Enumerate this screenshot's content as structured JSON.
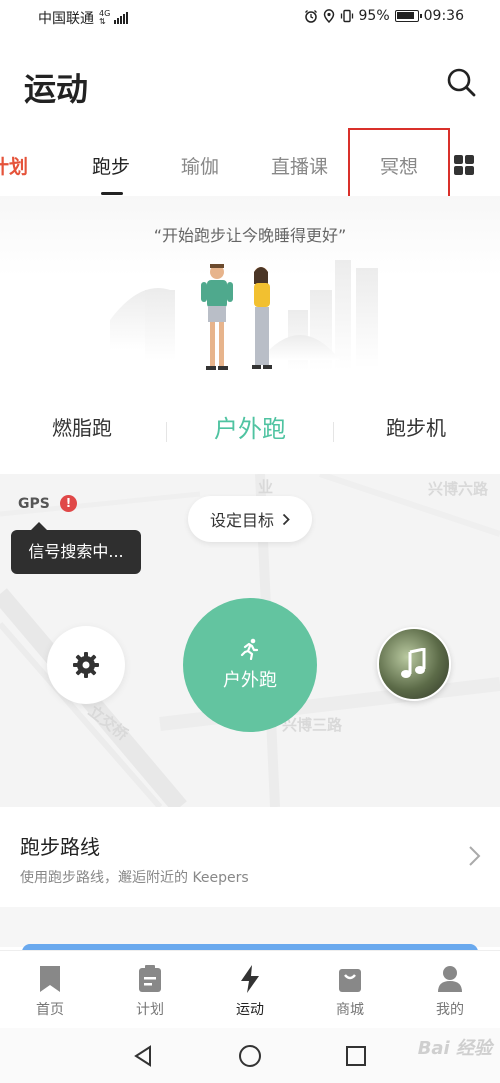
{
  "status_bar": {
    "carrier": "中国联通",
    "network_top": "4G",
    "network_bottom": "⇅",
    "battery": "95%",
    "time": "09:36"
  },
  "header": {
    "title": "运动"
  },
  "tabs": [
    {
      "label": "计划",
      "state": "partial"
    },
    {
      "label": "跑步",
      "state": "active"
    },
    {
      "label": "瑜伽",
      "state": "normal"
    },
    {
      "label": "直播课",
      "state": "normal"
    },
    {
      "label": "冥想",
      "state": "highlighted"
    }
  ],
  "hero": {
    "slogan": "“开始跑步让今晚睡得更好”"
  },
  "modes": [
    {
      "label": "燃脂跑",
      "active": false
    },
    {
      "label": "户外跑",
      "active": true
    },
    {
      "label": "跑步机",
      "active": false
    }
  ],
  "map": {
    "gps_label": "GPS",
    "gps_alert": "!",
    "gps_status": "信号搜索中...",
    "goal_label": "设定目标",
    "start_label": "户外跑",
    "street_labels": [
      "兴博六路",
      "兴博三路",
      "立交桥",
      "业"
    ]
  },
  "routes": {
    "title": "跑步路线",
    "subtitle": "使用跑步路线，邂逅附近的 Keepers"
  },
  "bottom_nav": [
    {
      "label": "首页",
      "icon": "bookmark-icon",
      "active": false
    },
    {
      "label": "计划",
      "icon": "clipboard-icon",
      "active": false
    },
    {
      "label": "运动",
      "icon": "lightning-icon",
      "active": true
    },
    {
      "label": "商城",
      "icon": "shopping-bag-icon",
      "active": false
    },
    {
      "label": "我的",
      "icon": "person-icon",
      "active": false
    }
  ],
  "watermark": "Bai 经验",
  "colors": {
    "accent": "#4fc3a1",
    "start_button": "#63c4a0",
    "highlight_box": "#d9302a",
    "partial_tab": "#e5533a"
  }
}
